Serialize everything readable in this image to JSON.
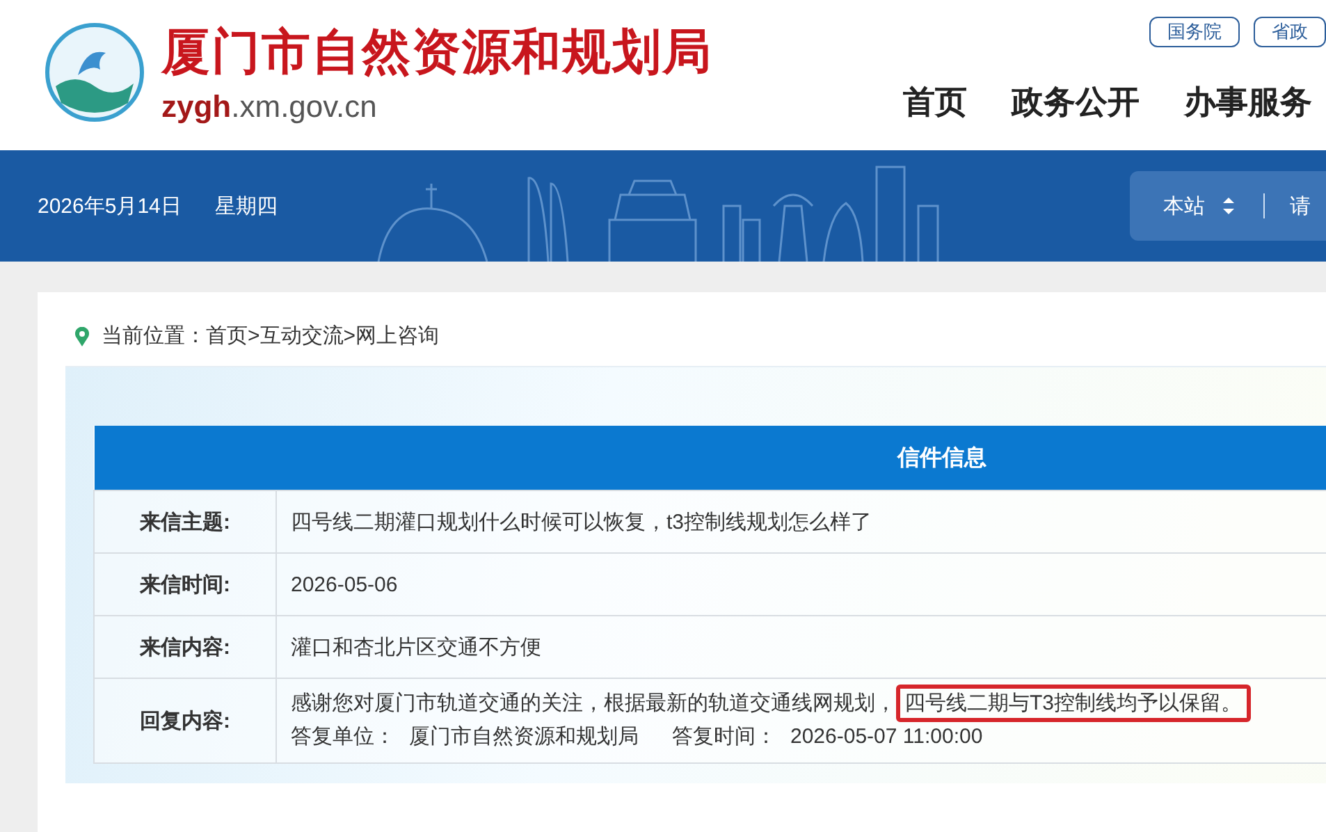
{
  "header": {
    "site_title": "厦门市自然资源和规划局",
    "domain": "**zygh**.xm.gov.cn",
    "top_links": [
      "国务院",
      "省政"
    ],
    "nav": [
      "首页",
      "政务公开",
      "办事服务"
    ]
  },
  "banner": {
    "date": "2026年5月14日",
    "weekday": "星期四",
    "search_scope": "本站",
    "search_placeholder": "请"
  },
  "breadcrumb": {
    "label": "当前位置：",
    "items": [
      "首页",
      "互动交流",
      "网上咨询"
    ],
    "separator": ">"
  },
  "letter": {
    "title": "信件信息",
    "rows": [
      {
        "kind": "text",
        "label": "来信主题:",
        "value": "四号线二期灌口规划什么时候可以恢复，t3控制线规划怎么样了"
      },
      {
        "kind": "text",
        "label": "来信时间:",
        "value": "2026-05-06"
      },
      {
        "kind": "text",
        "label": "来信内容:",
        "value": "灌口和杏北片区交通不方便"
      },
      {
        "kind": "reply",
        "label": "回复内容:",
        "value": "感谢您对厦门市轨道交通的关注，根据最新的轨道交通线网规划，",
        "highlight": "四号线二期与T3控制线均予以保留。",
        "unit_label": "答复单位：",
        "unit": "厦门市自然资源和规划局",
        "time_label": "答复时间：",
        "time": "2026-05-07 11:00:00"
      }
    ]
  }
}
